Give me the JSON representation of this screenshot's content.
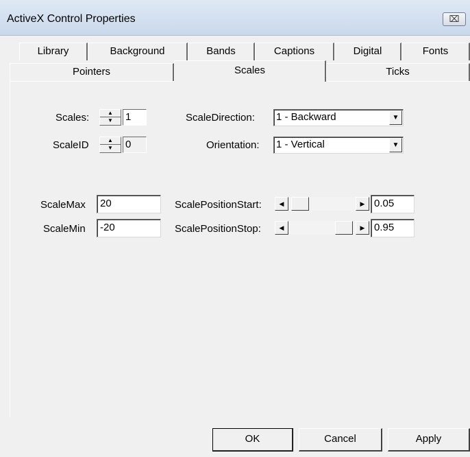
{
  "window": {
    "title": "ActiveX Control Properties",
    "close_glyph": "⌧"
  },
  "tabs_row1": [
    {
      "label": "Library"
    },
    {
      "label": "Background"
    },
    {
      "label": "Bands"
    },
    {
      "label": "Captions"
    },
    {
      "label": "Digital"
    },
    {
      "label": "Fonts"
    }
  ],
  "tabs_row2": [
    {
      "label": "Pointers"
    },
    {
      "label": "Scales",
      "active": true
    },
    {
      "label": "Ticks"
    }
  ],
  "scales": {
    "scales_label": "Scales:",
    "scales_value": "1",
    "scaleid_label": "ScaleID",
    "scaleid_value": "0",
    "direction_label": "ScaleDirection:",
    "direction_value": "1 - Backward",
    "orientation_label": "Orientation:",
    "orientation_value": "1 - Vertical",
    "max_label": "ScaleMax",
    "max_value": "20",
    "min_label": "ScaleMin",
    "min_value": "-20",
    "pos_start_label": "ScalePositionStart:",
    "pos_start_value": "0.05",
    "pos_start_fraction": 0.05,
    "pos_stop_label": "ScalePositionStop:",
    "pos_stop_value": "0.95",
    "pos_stop_fraction": 0.95
  },
  "buttons": {
    "ok": "OK",
    "cancel": "Cancel",
    "apply": "Apply"
  },
  "glyphs": {
    "spin_up": "▲",
    "spin_down": "▼",
    "combo_arrow": "▼",
    "scroll_left": "◀",
    "scroll_right": "▶"
  }
}
